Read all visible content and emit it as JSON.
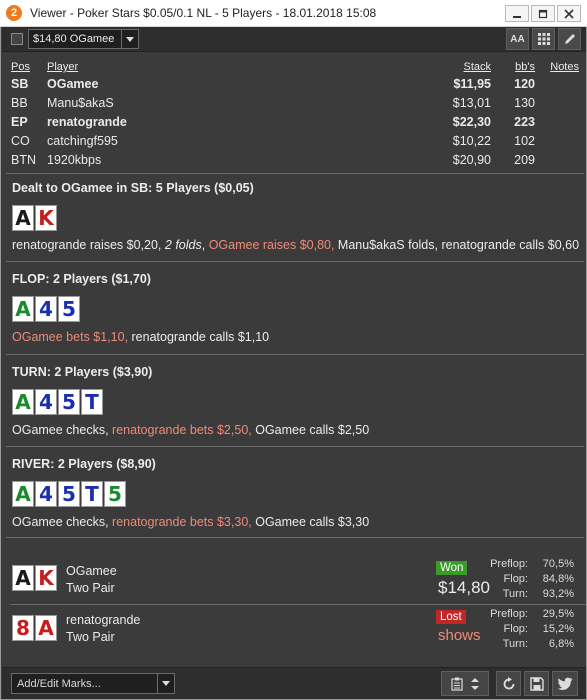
{
  "window": {
    "app_icon_label": "2",
    "title": "Viewer - Poker Stars $0.05/0.1 NL - 5 Players - 18.01.2018 15:08"
  },
  "toolbar": {
    "player_select_value": "$14,80 OGamee",
    "font_button_label": "AA"
  },
  "players_table": {
    "headers": {
      "pos": "Pos",
      "player": "Player",
      "stack": "Stack",
      "bbs": "bb's",
      "notes": "Notes"
    },
    "rows": [
      {
        "pos": "SB",
        "player": "OGamee",
        "stack": "$11,95",
        "bbs": "120",
        "bold": true
      },
      {
        "pos": "BB",
        "player": "Manu$akaS",
        "stack": "$13,01",
        "bbs": "130",
        "bold": false
      },
      {
        "pos": "EP",
        "player": "renatogrande",
        "stack": "$22,30",
        "bbs": "223",
        "bold": true
      },
      {
        "pos": "CO",
        "player": "catchingf595",
        "stack": "$10,22",
        "bbs": "102",
        "bold": false
      },
      {
        "pos": "BTN",
        "player": "1920kbps",
        "stack": "$20,90",
        "bbs": "209",
        "bold": false
      }
    ]
  },
  "preflop": {
    "title": "Dealt to OGamee in SB: 5 Players ($0,05)",
    "cards": [
      {
        "rank": "A",
        "color": "black"
      },
      {
        "rank": "K",
        "color": "red"
      }
    ],
    "actions": {
      "a1": "renatogrande raises $0,20, ",
      "a2": "2 folds",
      "a3": ", ",
      "a4": "OGamee raises $0,80,",
      "a5": " Manu$akaS folds, renatogrande calls $0,60"
    }
  },
  "flop": {
    "title": "FLOP: 2 Players ($1,70)",
    "cards": [
      {
        "rank": "A",
        "color": "green"
      },
      {
        "rank": "4",
        "color": "blue"
      },
      {
        "rank": "5",
        "color": "blue"
      }
    ],
    "actions": {
      "a1": "OGamee bets $1,10,",
      "a2": " renatogrande calls $1,10"
    }
  },
  "turn": {
    "title": "TURN: 2 Players ($3,90)",
    "cards": [
      {
        "rank": "A",
        "color": "green"
      },
      {
        "rank": "4",
        "color": "blue"
      },
      {
        "rank": "5",
        "color": "blue"
      },
      {
        "rank": "T",
        "color": "blue"
      }
    ],
    "actions": {
      "a1": "OGamee checks, ",
      "a2": "renatogrande bets $2,50,",
      "a3": " OGamee calls $2,50"
    }
  },
  "river": {
    "title": "RIVER: 2 Players ($8,90)",
    "cards": [
      {
        "rank": "A",
        "color": "green"
      },
      {
        "rank": "4",
        "color": "blue"
      },
      {
        "rank": "5",
        "color": "blue"
      },
      {
        "rank": "T",
        "color": "blue"
      },
      {
        "rank": "5",
        "color": "green"
      }
    ],
    "actions": {
      "a1": "OGamee checks, ",
      "a2": "renatogrande bets $3,30,",
      "a3": " OGamee calls $3,30"
    }
  },
  "results": [
    {
      "cards": [
        {
          "rank": "A",
          "color": "black"
        },
        {
          "rank": "K",
          "color": "red"
        }
      ],
      "name": "OGamee",
      "hand": "Two Pair",
      "badge": "Won",
      "amount": "$14,80",
      "equity": [
        {
          "label": "Preflop:",
          "value": "70,5%"
        },
        {
          "label": "Flop:",
          "value": "84,8%"
        },
        {
          "label": "Turn:",
          "value": "93,2%"
        }
      ]
    },
    {
      "cards": [
        {
          "rank": "8",
          "color": "red"
        },
        {
          "rank": "A",
          "color": "red"
        }
      ],
      "name": "renatogrande",
      "hand": "Two Pair",
      "badge": "Lost",
      "amount": "shows",
      "equity": [
        {
          "label": "Preflop:",
          "value": "29,5%"
        },
        {
          "label": "Flop:",
          "value": "15,2%"
        },
        {
          "label": "Turn:",
          "value": "6,8%"
        }
      ]
    }
  ],
  "bottom": {
    "marks_placeholder": "Add/Edit Marks..."
  },
  "colors": {
    "background": "#3b3b3b",
    "highlight_action": "#f08a78",
    "won_badge": "#3a9a2a",
    "lost_badge": "#c02828"
  }
}
